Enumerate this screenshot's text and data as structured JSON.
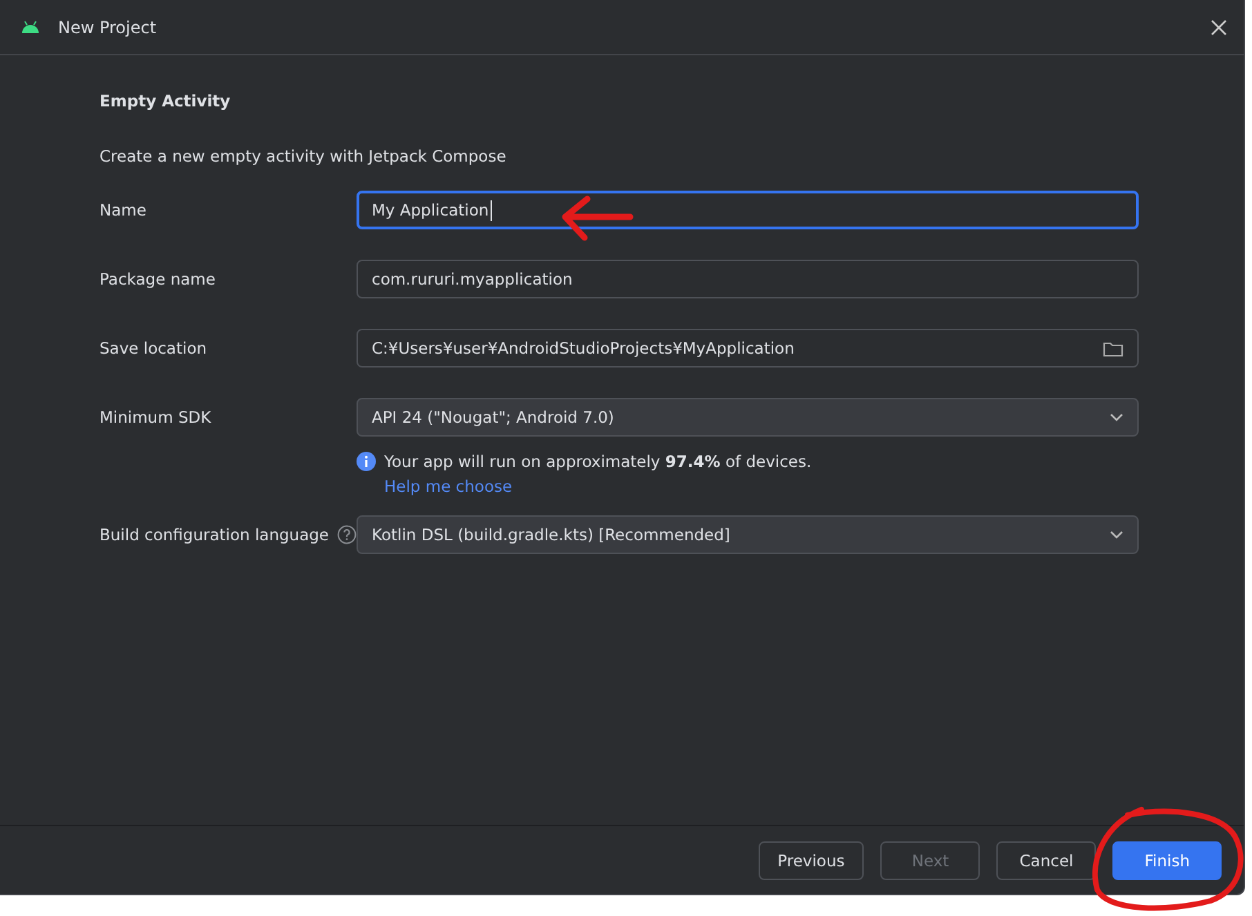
{
  "window": {
    "title": "New Project"
  },
  "template": {
    "title": "Empty Activity",
    "description": "Create a new empty activity with Jetpack Compose"
  },
  "fields": [
    {
      "label": "Name",
      "kind": "text",
      "value": "My Application",
      "focused": true
    },
    {
      "label": "Package name",
      "kind": "text",
      "value": "com.rururi.myapplication",
      "focused": false
    },
    {
      "label": "Save location",
      "kind": "folder",
      "value": "C:¥Users¥user¥AndroidStudioProjects¥MyApplication",
      "focused": false
    },
    {
      "label": "Minimum SDK",
      "kind": "dropdown",
      "value": "API 24 (\"Nougat\"; Android 7.0)",
      "focused": false,
      "info": "Your app will run on approximately **97.4%** of devices.",
      "link": "Help me choose"
    },
    {
      "label": "Build configuration language",
      "kind": "dropdown",
      "value": "Kotlin DSL (build.gradle.kts) [Recommended]",
      "focused": false,
      "help": true
    }
  ],
  "buttons": [
    {
      "label": "Previous",
      "kind": "default",
      "disabled": false
    },
    {
      "label": "Next",
      "kind": "default",
      "disabled": true
    },
    {
      "label": "Cancel",
      "kind": "default",
      "disabled": false
    },
    {
      "label": "Finish",
      "kind": "primary",
      "disabled": false
    }
  ]
}
